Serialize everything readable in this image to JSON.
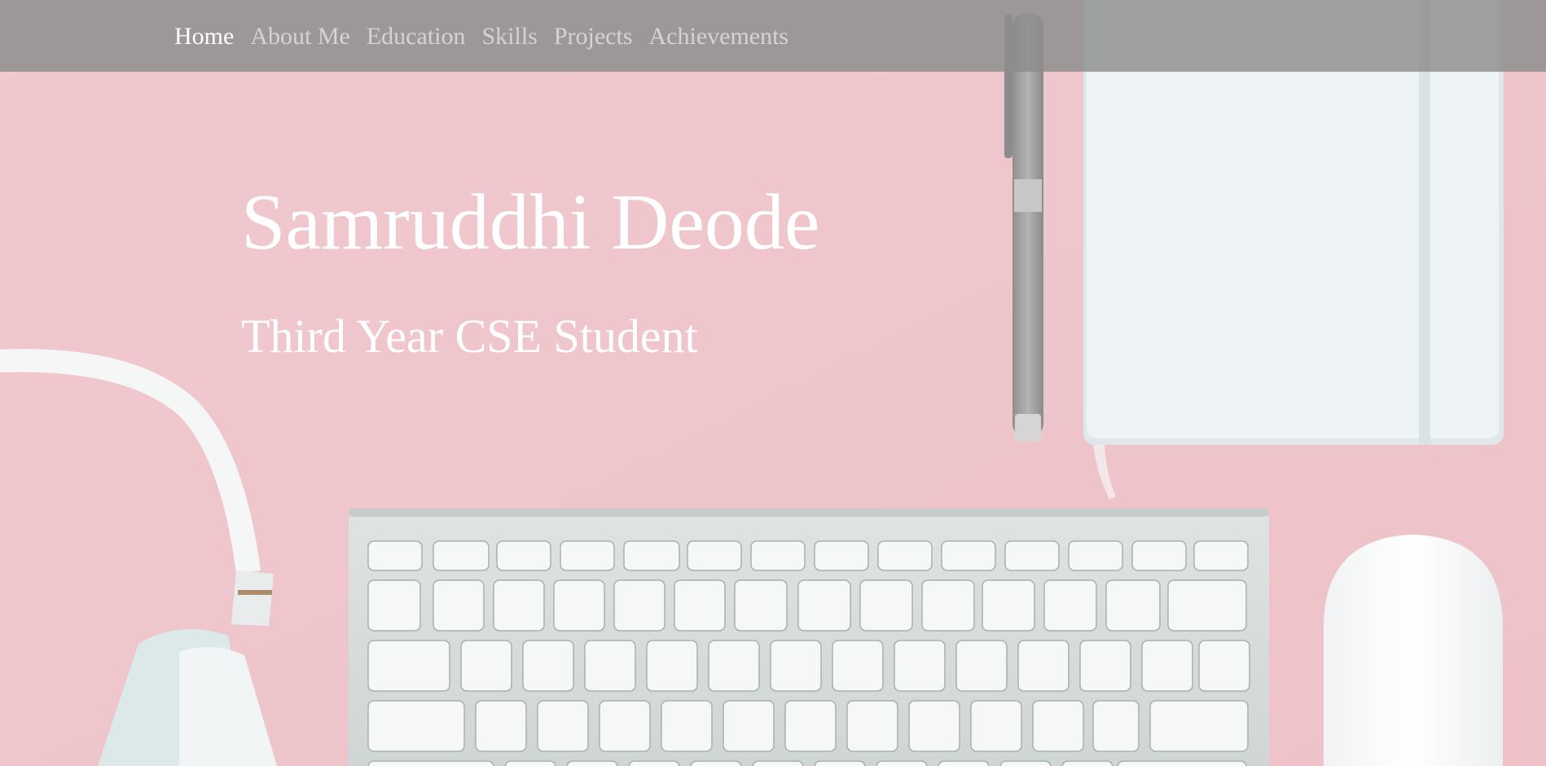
{
  "nav": {
    "items": [
      {
        "label": "Home",
        "active": true
      },
      {
        "label": "About Me",
        "active": false
      },
      {
        "label": "Education",
        "active": false
      },
      {
        "label": "Skills",
        "active": false
      },
      {
        "label": "Projects",
        "active": false
      },
      {
        "label": "Achievements",
        "active": false
      }
    ]
  },
  "hero": {
    "name": "Samruddhi Deode",
    "role": "Third Year CSE Student"
  },
  "background": {
    "objects": [
      "headphones",
      "pen",
      "notebook",
      "keyboard",
      "mouse"
    ],
    "base_color": "#eec7cd"
  },
  "colors": {
    "nav_active": "#ffffff",
    "nav_inactive": "#d8d2d2",
    "nav_bar": "#8c8c8c",
    "hero_text": "#ffffff"
  }
}
